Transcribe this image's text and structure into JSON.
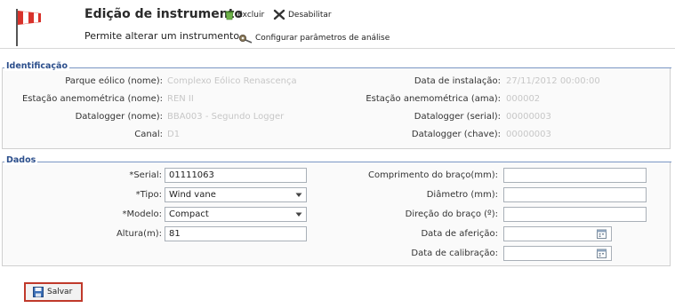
{
  "header": {
    "title": "Edição de instrumento",
    "subtitle": "Permite alterar um instrumento",
    "delete_label": "Excluir",
    "disable_label": "Desabilitar",
    "configure_label": "Configurar parâmetros de análise"
  },
  "identificacao": {
    "legend": "Identificação",
    "fields_left": [
      {
        "label": "Parque eólico (nome):",
        "value": "Complexo Eólico Renascença"
      },
      {
        "label": "Estação anemométrica (nome):",
        "value": "REN II"
      },
      {
        "label": "Datalogger (nome):",
        "value": "BBA003 - Segundo Logger"
      },
      {
        "label": "Canal:",
        "value": "D1"
      }
    ],
    "fields_right": [
      {
        "label": "Data de instalação:",
        "value": "27/11/2012 00:00:00"
      },
      {
        "label": "Estação anemométrica (ama):",
        "value": "000002"
      },
      {
        "label": "Datalogger (serial):",
        "value": "00000003"
      },
      {
        "label": "Datalogger (chave):",
        "value": "00000003"
      }
    ]
  },
  "dados": {
    "legend": "Dados",
    "left": [
      {
        "label": "*Serial:",
        "value": "01111063",
        "type": "text"
      },
      {
        "label": "*Tipo:",
        "value": "Wind vane",
        "type": "select"
      },
      {
        "label": "*Modelo:",
        "value": "Compact",
        "type": "select"
      },
      {
        "label": "Altura(m):",
        "value": "81",
        "type": "text"
      }
    ],
    "right": [
      {
        "label": "Comprimento do braço(mm):",
        "value": "",
        "type": "text"
      },
      {
        "label": "Diâmetro (mm):",
        "value": "",
        "type": "text"
      },
      {
        "label": "Direção do braço (º):",
        "value": "",
        "type": "text"
      },
      {
        "label": "Data de aferição:",
        "value": "",
        "type": "date"
      },
      {
        "label": "Data de calibração:",
        "value": "",
        "type": "date"
      }
    ]
  },
  "footer": {
    "save_label": "Salvar"
  },
  "colors": {
    "accent_red": "#c0392b",
    "legend_blue": "#2c4f8c"
  }
}
